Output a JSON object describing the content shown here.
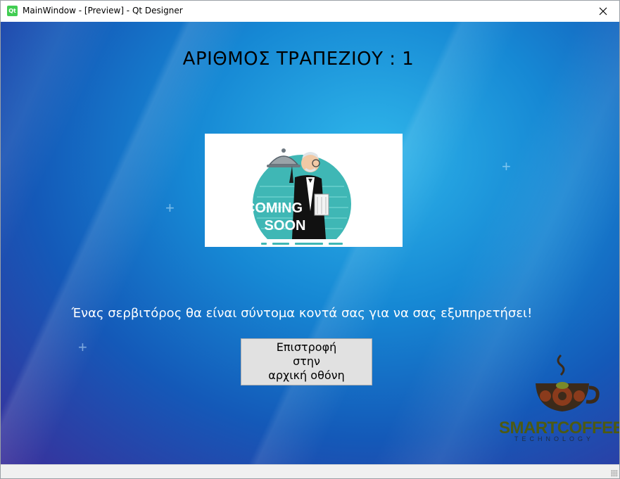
{
  "window": {
    "title": "MainWindow - [Preview] - Qt Designer",
    "app_icon": "qt-icon",
    "close_icon": "close-icon"
  },
  "main": {
    "heading": "ΑΡΙΘΜΟΣ ΤΡΑΠΕΖΙΟΥ : 1",
    "image": {
      "text_line1": "COMING",
      "text_line2": "SOON"
    },
    "message": "Ένας σερβιτόρος θα είναι σύντομα κοντά σας για να σας εξυπηρετήσει!",
    "back_button": {
      "line1": "Επιστροφή",
      "line2": "στην",
      "line3": "αρχική οθόνη"
    }
  },
  "logo": {
    "name_part1": "SMART",
    "name_part2": "COFFEE",
    "subtitle": "TECHNOLOGY",
    "color_green": "#4d5a12",
    "color_coffee": "#3b2a1a"
  },
  "colors": {
    "background_top": "#2fb6ea",
    "background_bottom": "#3a2f9a",
    "teal": "#3fb7b5"
  }
}
